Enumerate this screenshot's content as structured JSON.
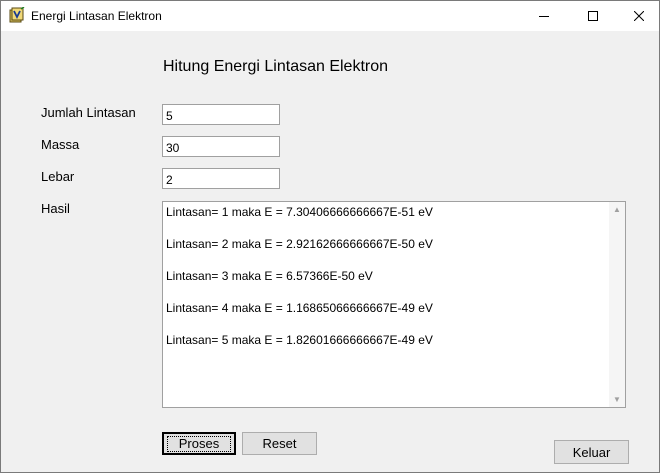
{
  "window": {
    "title": "Energi Lintasan Elektron"
  },
  "heading": "Hitung Energi Lintasan Elektron",
  "form": {
    "jumlah_label": "Jumlah Lintasan",
    "jumlah_value": "5",
    "massa_label": "Massa",
    "massa_value": "30",
    "lebar_label": "Lebar",
    "lebar_value": "2",
    "hasil_label": "Hasil"
  },
  "results": [
    "Lintasan= 1 maka E = 7.30406666666667E-51 eV",
    "Lintasan= 2 maka E = 2.92162666666667E-50 eV",
    "Lintasan= 3 maka E = 6.57366E-50 eV",
    "Lintasan= 4 maka E = 1.16865066666667E-49 eV",
    "Lintasan= 5 maka E = 1.82601666666667E-49 eV"
  ],
  "buttons": {
    "proses": "Proses",
    "reset": "Reset",
    "keluar": "Keluar"
  },
  "icons": {
    "app": "vb-form-icon",
    "minimize": "minimize-icon",
    "maximize": "maximize-icon",
    "close": "close-icon"
  }
}
